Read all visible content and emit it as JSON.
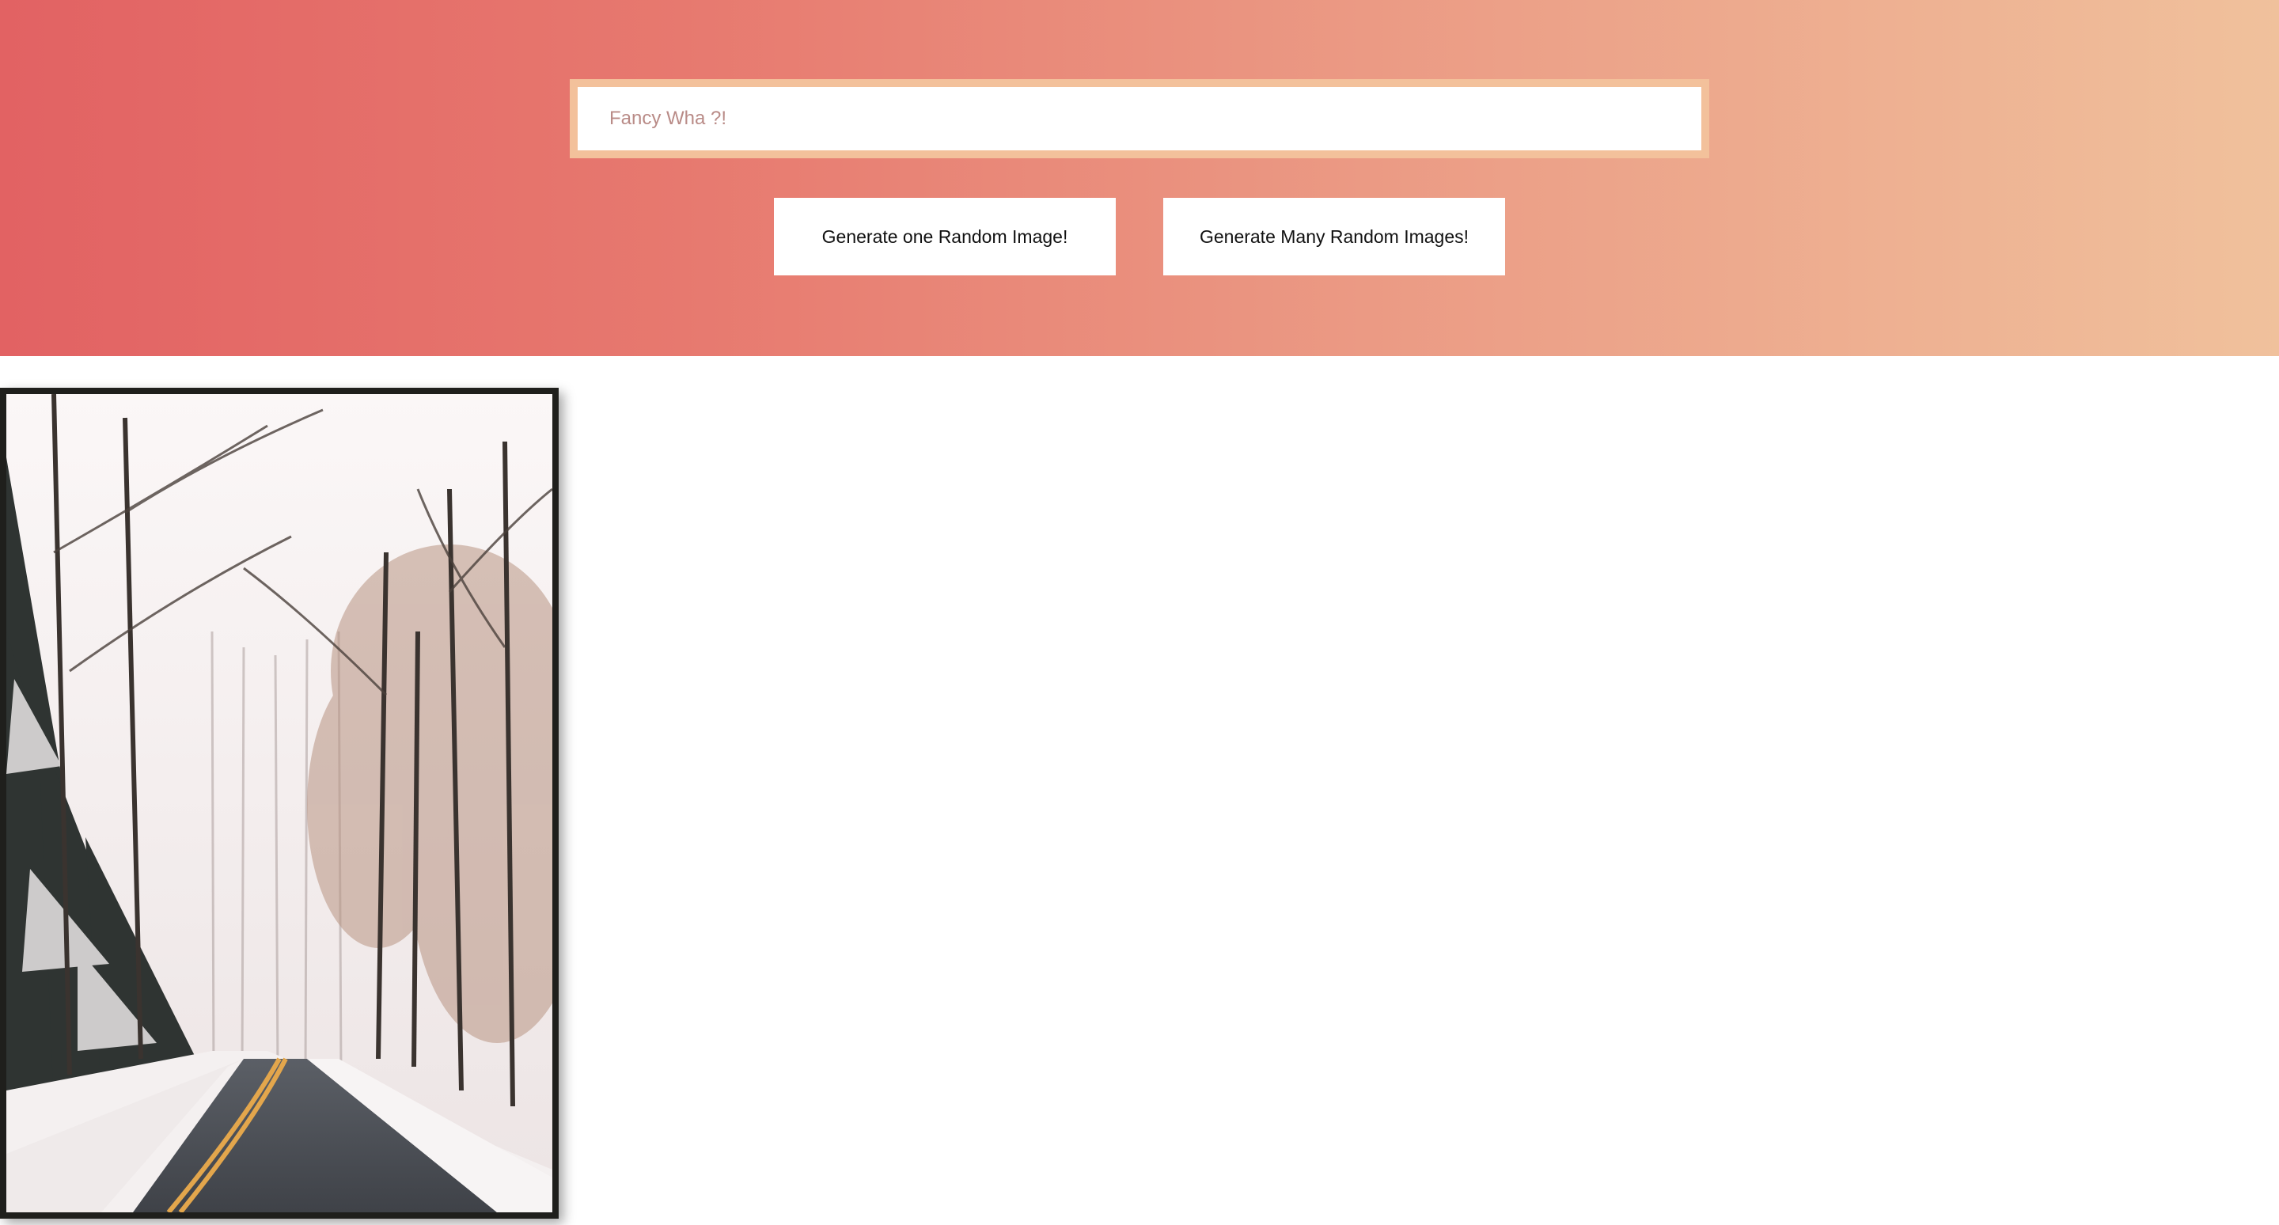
{
  "search": {
    "placeholder": "Fancy Wha ?!",
    "value": ""
  },
  "buttons": {
    "one_label": "Generate one Random Image!",
    "many_label": "Generate Many Random Images!"
  },
  "colors": {
    "gradient_start": "#e26263",
    "gradient_end": "#f0c19c",
    "search_frame": "#f3c19b",
    "card_border": "#1f1f1c"
  },
  "image": {
    "subject": "snowy forest road"
  }
}
